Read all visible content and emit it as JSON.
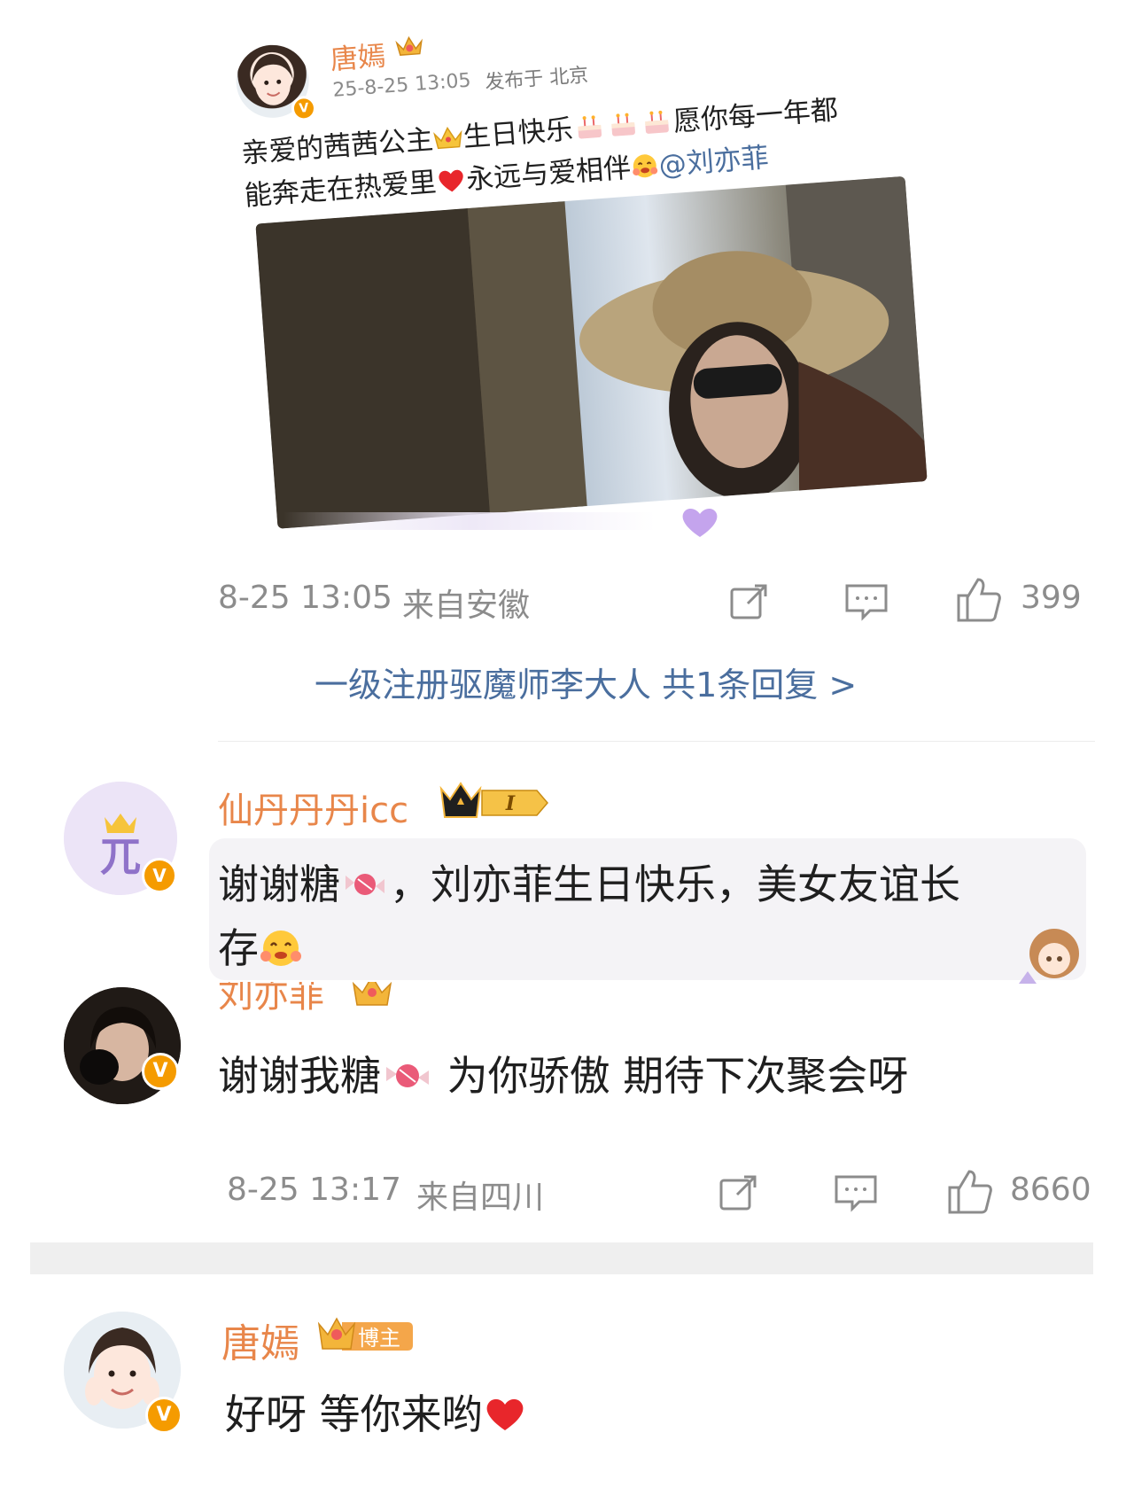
{
  "post": {
    "author": "唐嫣",
    "time": "25-8-25 13:05",
    "location": "发布于 北京",
    "text_line1_a": "亲爱的茜茜公主",
    "text_line1_b": "生日快乐",
    "text_line1_c": "愿你每一年都",
    "text_line2_a": "能奔走在热爱里",
    "text_line2_b": "永远与爱相伴",
    "mention": "@刘亦菲",
    "emojis": [
      "crown",
      "birthday-cake",
      "birthday-cake",
      "birthday-cake",
      "red-heart",
      "hug-face"
    ]
  },
  "comment1": {
    "time": "8-25 13:05",
    "source": "来自安徽",
    "likes": "399",
    "replies_link": "一级注册驱魔师李大人 共1条回复 >"
  },
  "reply1": {
    "author": "仙丹丹丹icc",
    "badge": "I",
    "text_line1": "谢谢糖",
    "text_line1_b": "，刘亦菲生日快乐，美女友谊长",
    "text_line2": "存"
  },
  "reply2": {
    "author": "刘亦菲",
    "text_a": "谢谢我糖",
    "text_b": "为你骄傲 期待下次聚会呀",
    "time": "8-25 13:17",
    "source": "来自四川",
    "likes": "8660"
  },
  "reply3": {
    "author": "唐嫣",
    "badge": "博主",
    "text": "好呀 等你来哟"
  },
  "colors": {
    "name_orange": "#e8864a",
    "link_blue": "#4a6e9e",
    "vip_badge": "#f59b00",
    "heart": "#e8262b"
  }
}
